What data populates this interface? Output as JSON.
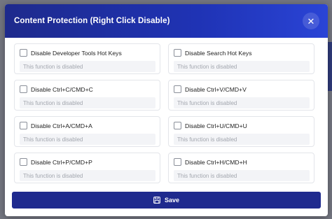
{
  "modal": {
    "title": "Content Protection (Right Click Disable)",
    "close_icon": "close-icon",
    "options": [
      {
        "label": "Disable Developer Tools Hot Keys",
        "status": "This function is disabled",
        "checked": false
      },
      {
        "label": "Disable Search Hot Keys",
        "status": "This function is disabled",
        "checked": false
      },
      {
        "label": "Disable Ctrl+C/CMD+C",
        "status": "This function is disabled",
        "checked": false
      },
      {
        "label": "Disable Ctrl+V/CMD+V",
        "status": "This function is disabled",
        "checked": false
      },
      {
        "label": "Disable Ctrl+A/CMD+A",
        "status": "This function is disabled",
        "checked": false
      },
      {
        "label": "Disable Ctrl+U/CMD+U",
        "status": "This function is disabled",
        "checked": false
      },
      {
        "label": "Disable Ctrl+P/CMD+P",
        "status": "This function is disabled",
        "checked": false
      },
      {
        "label": "Disable Ctrl+H/CMD+H",
        "status": "This function is disabled",
        "checked": false
      }
    ],
    "save_label": "Save",
    "save_icon": "save-icon"
  },
  "colors": {
    "header_start": "#1e2a8c",
    "header_end": "#2a44d6",
    "button": "#1f2a8e"
  }
}
